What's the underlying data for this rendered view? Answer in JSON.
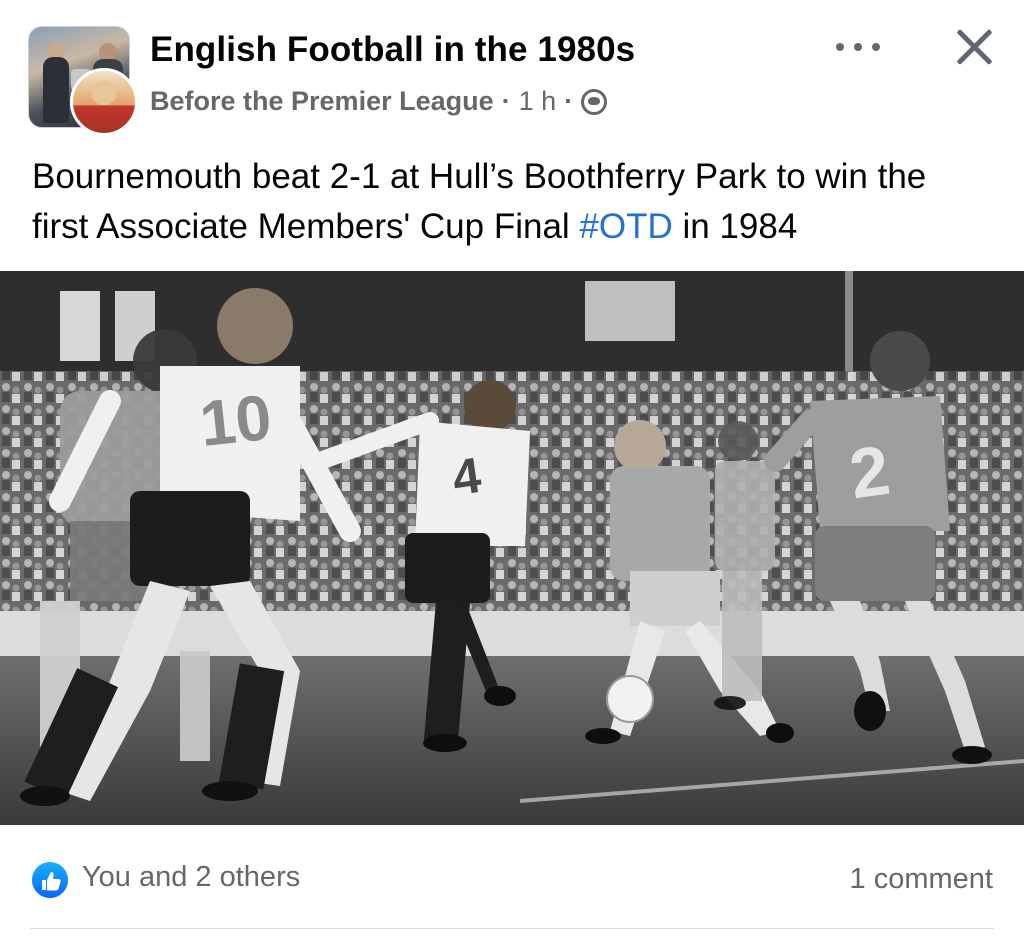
{
  "header": {
    "group_name": "English Football in the 1980s",
    "author": "Before the Premier League",
    "time": "1 h",
    "separator": "·",
    "audience_icon": "globe-icon",
    "more_icon": "more-icon",
    "close_icon": "close-icon"
  },
  "post": {
    "text_before": "Bournemouth beat 2-1 at Hull’s Boothferry Park to win the first Associate Members' Cup Final ",
    "hashtag": "#OTD",
    "text_after": " in 1984",
    "photo_shirt_numbers": [
      "10",
      "4",
      "2"
    ]
  },
  "footer": {
    "reaction_icon": "like-icon",
    "reactions": "You and 2 others",
    "comments": "1 comment"
  },
  "colors": {
    "text": "#050505",
    "secondary": "#65676b",
    "link": "#216fdb",
    "like": "#0866ff"
  }
}
